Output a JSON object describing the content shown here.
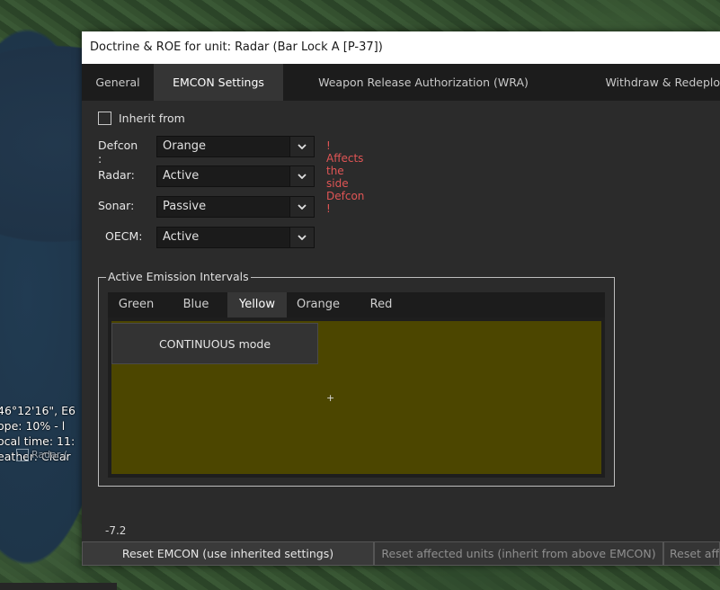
{
  "map": {
    "info_lines": [
      "46°12'16\", E6",
      "ope: 10%  - l",
      "ocal time: 11:",
      "eather: Clear"
    ],
    "marker_label": "Radar ("
  },
  "dialog": {
    "title": "Doctrine & ROE for unit: Radar (Bar Lock A [P-37])",
    "tabs": [
      {
        "label": "General",
        "active": false
      },
      {
        "label": "EMCON Settings",
        "active": true
      },
      {
        "label": "Weapon Release Authorization (WRA)",
        "active": false
      },
      {
        "label": "Withdraw & Redeplo",
        "active": false
      }
    ],
    "inherit_label": "Inherit from",
    "inherit_checked": false,
    "defcon": {
      "label": "Defcon :",
      "value": "Orange",
      "warning": "! Affects the side Defcon !"
    },
    "radar": {
      "label": "Radar:",
      "value": "Active"
    },
    "sonar": {
      "label": "Sonar:",
      "value": "Passive"
    },
    "oecm": {
      "label": "OECM:",
      "value": "Active"
    },
    "intervals": {
      "title": "Active Emission Intervals",
      "tabs": [
        {
          "label": "Green",
          "active": false
        },
        {
          "label": "Blue",
          "active": false
        },
        {
          "label": "Yellow",
          "active": true
        },
        {
          "label": "Orange",
          "active": false
        },
        {
          "label": "Red",
          "active": false
        }
      ],
      "mode_button": "CONTINUOUS mode",
      "cursor": "+",
      "panel_color": "#4c4600"
    },
    "status_value": "-7.2",
    "buttons": {
      "reset_emcon": "Reset EMCON (use inherited settings)",
      "reset_affected": "Reset affected units (inherit from above EMCON)",
      "reset_aff": "Reset aff"
    }
  }
}
